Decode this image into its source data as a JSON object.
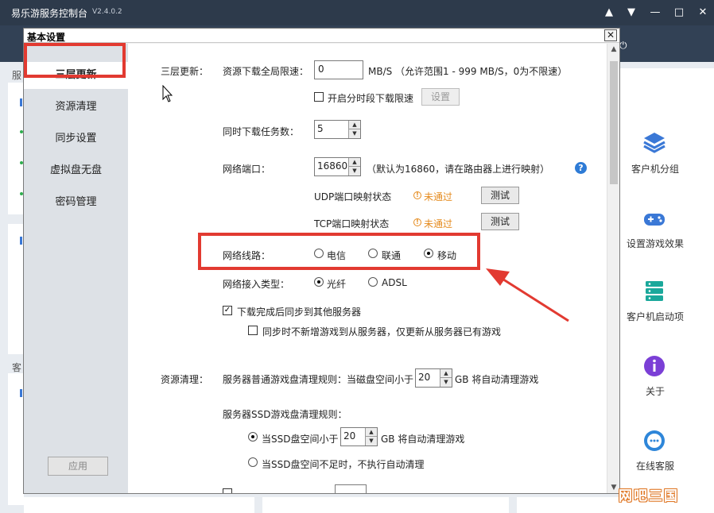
{
  "app": {
    "title": "易乐游服务控制台",
    "version": "V2.4.0.2",
    "bg_label_1": "服",
    "bg_label_2": "客",
    "colors": {
      "titlebar": "#2d3a4b",
      "accent": "#3a78d6",
      "highlight": "#e23a31"
    }
  },
  "right_panel": [
    {
      "label": "客户机分组",
      "icon": "layers-icon"
    },
    {
      "label": "设置游戏效果",
      "icon": "gamepad-icon"
    },
    {
      "label": "客户机启动项",
      "icon": "server-icon"
    },
    {
      "label": "关于",
      "icon": "info-icon"
    },
    {
      "label": "在线客服",
      "icon": "chat-icon"
    }
  ],
  "watermark": "网吧三国",
  "dialog": {
    "title": "基本设置",
    "close": "✕",
    "nav": [
      "三层更新",
      "资源清理",
      "同步设置",
      "虚拟盘无盘",
      "密码管理"
    ],
    "apply": "应用"
  },
  "three_layer": {
    "section_label": "三层更新：",
    "speed_label": "资源下载全局限速：",
    "speed_value": "0",
    "speed_unit": "MB/S （允许范围1 - 999 MB/S，0为不限速）",
    "period_limit_label": "开启分时段下载限速",
    "settings_btn": "设置",
    "tasks_label": "同时下载任务数：",
    "tasks_value": "5",
    "port_label": "网络端口：",
    "port_value": "16860",
    "port_hint": "（默认为16860，请在路由器上进行映射）",
    "udp_label": "UDP端口映射状态",
    "udp_status": "未通过",
    "tcp_label": "TCP端口映射状态",
    "tcp_status": "未通过",
    "test_btn": "测试",
    "line_label": "网络线路：",
    "line_options": [
      "电信",
      "联通",
      "移动"
    ],
    "line_selected": "移动",
    "access_label": "网络接入类型：",
    "access_options": [
      "光纤",
      "ADSL"
    ],
    "access_selected": "光纤",
    "sync_after_download": "下载完成后同步到其他服务器",
    "sync_no_new": "同步时不新增游戏到从服务器，仅更新从服务器已有游戏"
  },
  "cleanup": {
    "section_label": "资源清理：",
    "rule_prefix": "服务器普通游戏盘清理规则：当磁盘空间小于",
    "rule_value": "20",
    "rule_suffix": "GB 将自动清理游戏",
    "ssd_label": "服务器SSD游戏盘清理规则：",
    "ssd_opt1_prefix": "当SSD盘空间小于",
    "ssd_value": "20",
    "ssd_opt1_suffix": "GB 将自动清理游戏",
    "ssd_opt2": "当SSD盘空间不足时，不执行自动清理"
  }
}
